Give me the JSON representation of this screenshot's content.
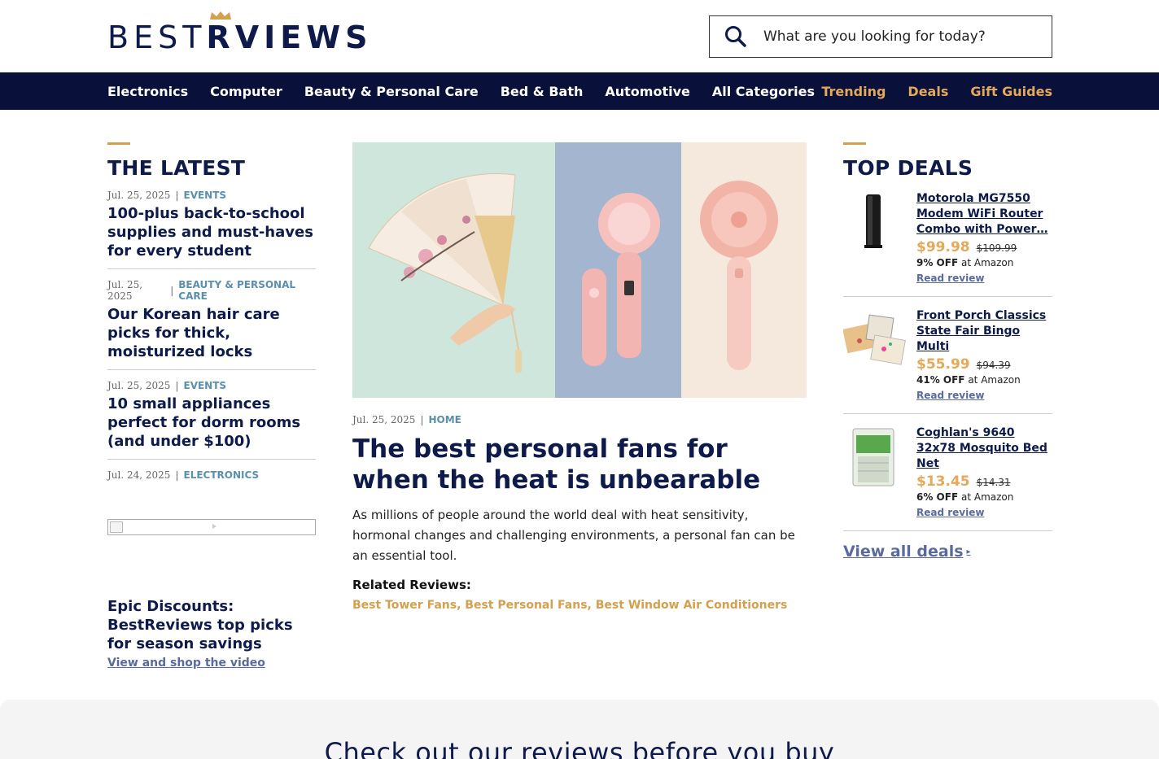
{
  "brand": {
    "logo_part1": "BEST",
    "logo_part2": "R",
    "logo_part3": "VIEWS",
    "accent": "#d4a04e",
    "navy": "#09103a"
  },
  "search": {
    "placeholder": "What are you looking for today?",
    "icon": "search-icon"
  },
  "nav": {
    "left": [
      "Electronics",
      "Computer",
      "Beauty & Personal Care",
      "Bed & Bath",
      "Automotive",
      "All Categories"
    ],
    "right": [
      "Trending",
      "Deals",
      "Gift Guides"
    ]
  },
  "latest": {
    "heading": "THE LATEST",
    "items": [
      {
        "date": "Jul. 25, 2025",
        "category": "EVENTS",
        "title": "100-plus back-to-school supplies and must-haves for every student"
      },
      {
        "date": "Jul. 25, 2025",
        "category": "BEAUTY & PERSONAL CARE",
        "title": "Our Korean hair care picks for thick, moisturized locks"
      },
      {
        "date": "Jul. 25, 2025",
        "category": "EVENTS",
        "title": "10 small appliances perfect for dorm rooms (and under $100)"
      },
      {
        "date": "Jul. 24, 2025",
        "category": "ELECTRONICS",
        "title": ""
      }
    ],
    "promo_title": "Epic Discounts: BestReviews top picks for season savings",
    "promo_link": "View and shop the video"
  },
  "feature": {
    "date": "Jul. 25, 2025",
    "category": "HOME",
    "title": "The best personal fans for when the heat is unbearable",
    "description": "As millions of people around the world deal with heat sensitivity, hormonal changes and challenging environments, a personal fan can be an essential tool.",
    "related_label": "Related Reviews:",
    "related": [
      "Best Tower Fans",
      "Best Personal Fans",
      "Best Window Air Conditioners"
    ]
  },
  "deals": {
    "heading": "TOP DEALS",
    "items": [
      {
        "name": "Motorola MG7550 Modem WiFi Router Combo with Power…",
        "price": "$99.98",
        "old_price": "$109.99",
        "off": "9% OFF",
        "store": "at Amazon",
        "read": "Read review"
      },
      {
        "name": "Front Porch Classics State Fair Bingo Multi",
        "price": "$55.99",
        "old_price": "$94.39",
        "off": "41% OFF",
        "store": "at Amazon",
        "read": "Read review"
      },
      {
        "name": "Coghlan's 9640 32x78 Mosquito Bed Net",
        "price": "$13.45",
        "old_price": "$14.31",
        "off": "6% OFF",
        "store": "at Amazon",
        "read": "Read review"
      }
    ],
    "view_all": "View all deals"
  },
  "bottom": {
    "title": "Check out our reviews before you buy"
  }
}
